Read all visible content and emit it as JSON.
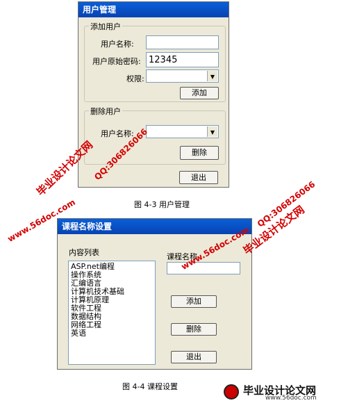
{
  "user_dialog": {
    "title": "用户管理",
    "add_group": {
      "legend": "添加用户",
      "username_label": "用户名称:",
      "username_value": "",
      "password_label": "用户原始密码:",
      "password_value": "12345",
      "permission_label": "权限:",
      "permission_value": "",
      "add_button": "添加"
    },
    "delete_group": {
      "legend": "删除用户",
      "username_label": "用户名称:",
      "username_value": "",
      "delete_button": "删除"
    },
    "exit_button": "退出"
  },
  "caption1": "图 4-3  用户管理",
  "course_dialog": {
    "title": "课程名称设置",
    "list_label": "内容列表",
    "list_items": [
      "ASP.net编程",
      "操作系统",
      "汇编语言",
      "计算机技术基础",
      "计算机原理",
      "软件工程",
      "数据结构",
      "网络工程",
      "英语"
    ],
    "name_label": "课程名称",
    "name_value": "",
    "add_button": "添加",
    "delete_button": "删除",
    "exit_button": "退出"
  },
  "caption2": "图 4-4 课程设置",
  "watermarks": {
    "site_title": "毕业设计论文网",
    "qq": "QQ:306826066",
    "url": "www.56doc.com",
    "footer_url": "www.56doc.com"
  },
  "colors": {
    "watermark": "#d40000",
    "titlebar": "#0a5fd8",
    "dialog_bg": "#ece9d8"
  }
}
